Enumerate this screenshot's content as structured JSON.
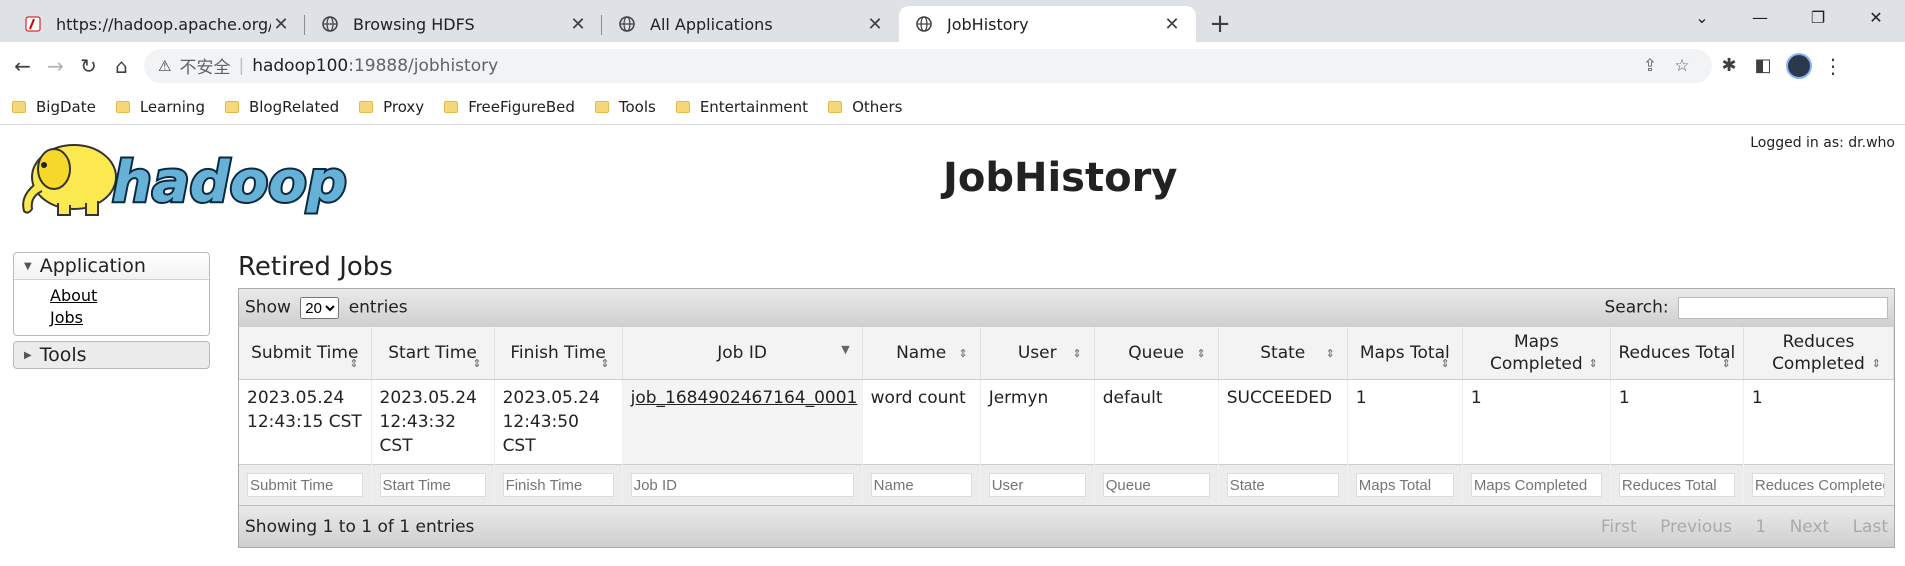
{
  "browser": {
    "tabs": [
      {
        "title": "https://hadoop.apache.org/do",
        "icon": "pdf-icon",
        "active": false
      },
      {
        "title": "Browsing HDFS",
        "icon": "globe-icon",
        "active": false
      },
      {
        "title": "All Applications",
        "icon": "globe-icon",
        "active": false
      },
      {
        "title": "JobHistory",
        "icon": "globe-icon",
        "active": true
      }
    ],
    "address": {
      "insecure_label": "不安全",
      "host": "hadoop100",
      "rest": ":19888/jobhistory"
    },
    "bookmarks": [
      "BigDate",
      "Learning",
      "BlogRelated",
      "Proxy",
      "FreeFigureBed",
      "Tools",
      "Entertainment",
      "Others"
    ]
  },
  "page": {
    "logo_text": "hadoop",
    "login": "Logged in as: dr.who",
    "title": "JobHistory",
    "nav": {
      "application": "Application",
      "about": "About",
      "jobs": "Jobs",
      "tools": "Tools"
    },
    "section_title": "Retired Jobs",
    "table": {
      "show_label": "Show",
      "entries_label": "entries",
      "page_size": "20",
      "search_label": "Search:",
      "columns": [
        "Submit Time",
        "Start Time",
        "Finish Time",
        "Job ID",
        "Name",
        "User",
        "Queue",
        "State",
        "Maps Total",
        "Maps Completed",
        "Reduces Total",
        "Reduces Completed"
      ],
      "rows": [
        [
          "2023.05.24 12:43:15 CST",
          "2023.05.24 12:43:32 CST",
          "2023.05.24 12:43:50 CST",
          "job_1684902467164_0001",
          "word count",
          "Jermyn",
          "default",
          "SUCCEEDED",
          "1",
          "1",
          "1",
          "1"
        ]
      ],
      "info": "Showing 1 to 1 of 1 entries",
      "pager": {
        "first": "First",
        "previous": "Previous",
        "page": "1",
        "next": "Next",
        "last": "Last"
      }
    }
  }
}
